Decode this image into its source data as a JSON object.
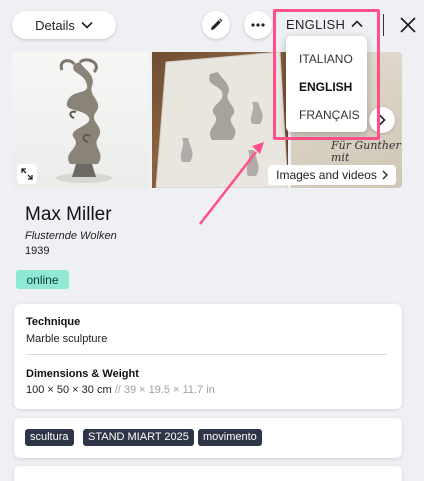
{
  "header": {
    "details_label": "Details",
    "language_current": "ENGLISH"
  },
  "language_menu": {
    "options": [
      {
        "label": "ITALIANO",
        "selected": false
      },
      {
        "label": "ENGLISH",
        "selected": true
      },
      {
        "label": "FRANÇAIS",
        "selected": false
      }
    ]
  },
  "gallery": {
    "images_videos_label": "Images and videos",
    "handwriting_line1": "Für Gunther",
    "handwriting_line2": "mit Zuneigung."
  },
  "artwork": {
    "artist": "Max Miller",
    "title": "Flusternde Wolken",
    "year": "1939",
    "status": "online"
  },
  "info": {
    "technique_label": "Technique",
    "technique_value": "Marble sculpture",
    "dimensions_label": "Dimensions & Weight",
    "dimensions_cm": "100 × 50 × 30 cm",
    "dimensions_in": "// 39 × 19.5 × 11.7 in"
  },
  "tags": [
    "scultura",
    "STAND MIART 2025",
    "movimento"
  ],
  "colors": {
    "highlight": "#ff4f8a",
    "status_badge": "#8ee8d4",
    "tag_bg": "#2f3548"
  },
  "icons": [
    "chevron-down-icon",
    "pencil-icon",
    "more-icon",
    "chevron-up-icon",
    "close-icon",
    "expand-icon",
    "chevron-right-icon"
  ]
}
